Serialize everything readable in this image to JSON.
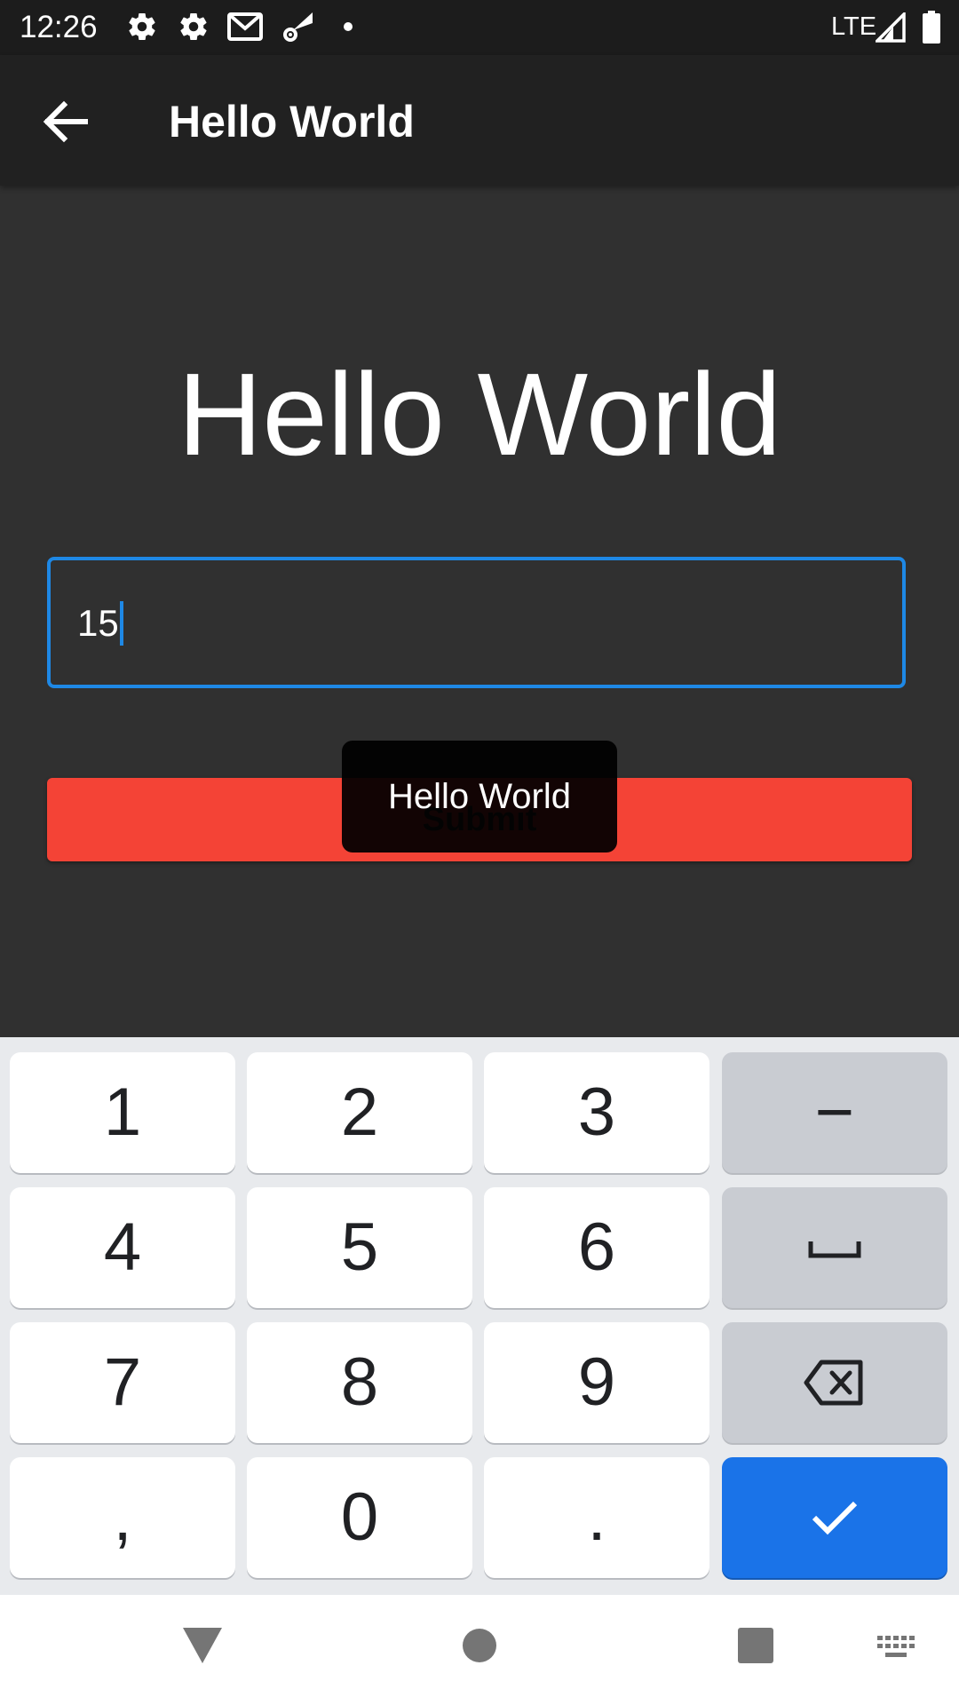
{
  "status_bar": {
    "time": "12:26",
    "network": "LTE",
    "icons": [
      "settings-icon",
      "settings-icon",
      "gmail-icon",
      "wifi-settings-icon",
      "dot-icon",
      "signal-icon",
      "battery-icon"
    ]
  },
  "app_bar": {
    "title": "Hello World",
    "back_icon": "arrow-back-icon"
  },
  "main": {
    "heading": "Hello World",
    "number_field": {
      "value": "15"
    },
    "submit_label": "Submit"
  },
  "toast": {
    "text": "Hello World"
  },
  "keyboard": {
    "keys": [
      "1",
      "2",
      "3",
      "−",
      "4",
      "5",
      "6",
      "space",
      "7",
      "8",
      "9",
      "backspace",
      ",",
      "0",
      ".",
      "done"
    ]
  },
  "colors": {
    "accent": "#1e88e5",
    "submit": "#f44336",
    "keyboard_action": "#1a73e8",
    "background": "#303030"
  }
}
